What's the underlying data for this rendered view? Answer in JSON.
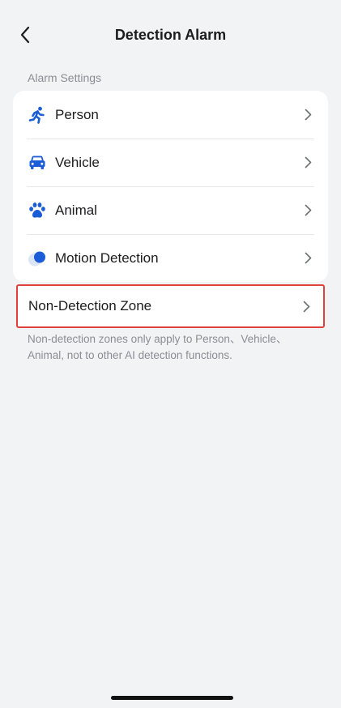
{
  "header": {
    "title": "Detection Alarm",
    "back_icon": "chevron-left-icon"
  },
  "section": {
    "label": "Alarm Settings"
  },
  "settings": {
    "items": [
      {
        "id": "person",
        "label": "Person",
        "icon": "running-person-icon"
      },
      {
        "id": "vehicle",
        "label": "Vehicle",
        "icon": "car-icon"
      },
      {
        "id": "animal",
        "label": "Animal",
        "icon": "paw-icon"
      },
      {
        "id": "motion",
        "label": "Motion Detection",
        "icon": "motion-dot-icon"
      }
    ]
  },
  "non_detection_zone": {
    "label": "Non-Detection Zone",
    "note": "Non-detection zones only apply to Person、Vehicle、Animal, not to other AI detection functions."
  },
  "colors": {
    "accent": "#1a5dd6",
    "highlight_border": "#e0423b",
    "background": "#f2f3f5",
    "muted_text": "#8a8d93"
  }
}
